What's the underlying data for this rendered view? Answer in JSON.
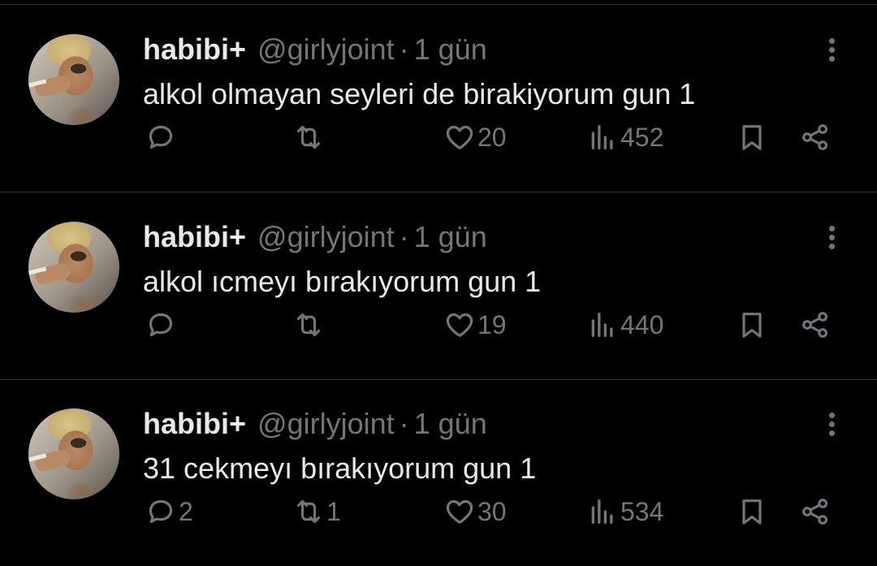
{
  "tweets": [
    {
      "name": "habibi+",
      "handle": "@girlyjoint",
      "separator": "·",
      "time": "1 gün",
      "text": "alkol olmayan seyleri de birakiyorum gun 1",
      "replies": "",
      "retweets": "",
      "likes": "20",
      "views": "452"
    },
    {
      "name": "habibi+",
      "handle": "@girlyjoint",
      "separator": "·",
      "time": "1 gün",
      "text": "alkol ıcmeyı bırakıyorum gun 1",
      "replies": "",
      "retweets": "",
      "likes": "19",
      "views": "440"
    },
    {
      "name": "habibi+",
      "handle": "@girlyjoint",
      "separator": "·",
      "time": "1 gün",
      "text": "31 cekmeyı bırakıyorum gun 1",
      "replies": "2",
      "retweets": "1",
      "likes": "30",
      "views": "534"
    }
  ],
  "icons": {
    "reply": "speech-bubble-icon",
    "retweet": "repost-arrows-icon",
    "like": "heart-icon",
    "views": "bar-chart-icon",
    "bookmark": "bookmark-icon",
    "share": "share-nodes-icon",
    "more": "vertical-ellipsis-icon"
  },
  "colors": {
    "background": "#000000",
    "text": "#e7e9ea",
    "muted": "#71767b",
    "divider": "#2f3336"
  }
}
